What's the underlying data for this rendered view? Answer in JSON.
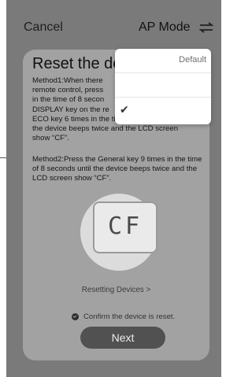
{
  "header": {
    "cancel_label": "Cancel",
    "mode_label": "AP Mode",
    "switch_icon": "switch-arrows-icon"
  },
  "card": {
    "title": "Reset the de",
    "method1_lines": [
      "Method1:When there",
      "remote control, press",
      "in the time of 8 secon",
      "DISPLAY key on the re",
      "ECO key 6 times in the time of 8 seconds until",
      "the device beeps twice and the LCD screen",
      "show “CF”."
    ],
    "method2_text": "Method2:Press the General key 9 times in the time of 8 seconds until the device beeps twice and the LCD screen show “CF”.",
    "lcd_text": "CF",
    "reset_link": "Resetting Devices >",
    "confirm_text": "Confirm the device is reset.",
    "next_label": "Next"
  },
  "dropdown": {
    "items": [
      {
        "label": "Default",
        "checked": false
      },
      {
        "label": "",
        "checked": false
      },
      {
        "label": "",
        "checked": true
      }
    ]
  },
  "colors": {
    "screen_bg": "#7a7a7a",
    "card_bg": "#a2a2a2",
    "button_bg": "#515151",
    "dropdown_bg": "#ffffff"
  }
}
